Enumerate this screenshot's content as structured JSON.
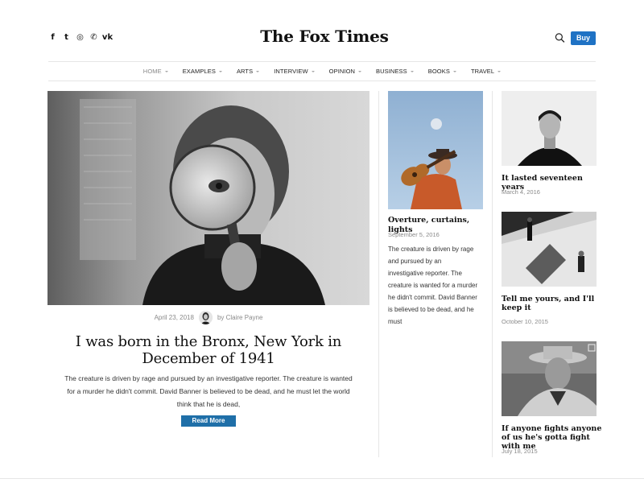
{
  "site": {
    "brand": "The Fox Times",
    "buy_label": "Buy",
    "socials": [
      {
        "icon": "facebook-icon",
        "glyph": "f"
      },
      {
        "icon": "twitter-icon",
        "glyph": "t"
      },
      {
        "icon": "instagram-icon",
        "glyph": "◎"
      },
      {
        "icon": "whatsapp-icon",
        "glyph": "✆"
      },
      {
        "icon": "vk-icon",
        "glyph": "vk"
      }
    ],
    "accent_color": "#1f72c4"
  },
  "nav": {
    "items": [
      {
        "label": "HOME",
        "active": true
      },
      {
        "label": "EXAMPLES"
      },
      {
        "label": "ARTS"
      },
      {
        "label": "INTERVIEW"
      },
      {
        "label": "OPINION"
      },
      {
        "label": "BUSINESS"
      },
      {
        "label": "BOOKS"
      },
      {
        "label": "TRAVEL"
      }
    ]
  },
  "feature": {
    "date": "April 23, 2018",
    "author": "by Claire Payne",
    "title": "I was born in the Bronx, New York in December of 1941",
    "excerpt": "The creature is driven by rage and pursued by an investigative reporter. The creature is wanted for a murder he didn't commit. David Banner is believed to be dead, and he must let the world think that he is dead,",
    "read_more": "Read More"
  },
  "middle": {
    "title": "Overture, curtains, lights",
    "date": "September 5, 2016",
    "excerpt": "The creature is driven by rage and pursued by an investigative reporter. The creature is wanted for a murder he didn't commit. David Banner is believed to be dead, and he must"
  },
  "right": {
    "cards": [
      {
        "title": "It lasted seventeen years",
        "date": "March 4, 2016"
      },
      {
        "title": "Tell me yours, and I'll keep it",
        "date": "October 10, 2015"
      },
      {
        "title": "If anyone fights anyone of us he's gotta fight with me",
        "date": "July 18, 2015"
      }
    ]
  }
}
